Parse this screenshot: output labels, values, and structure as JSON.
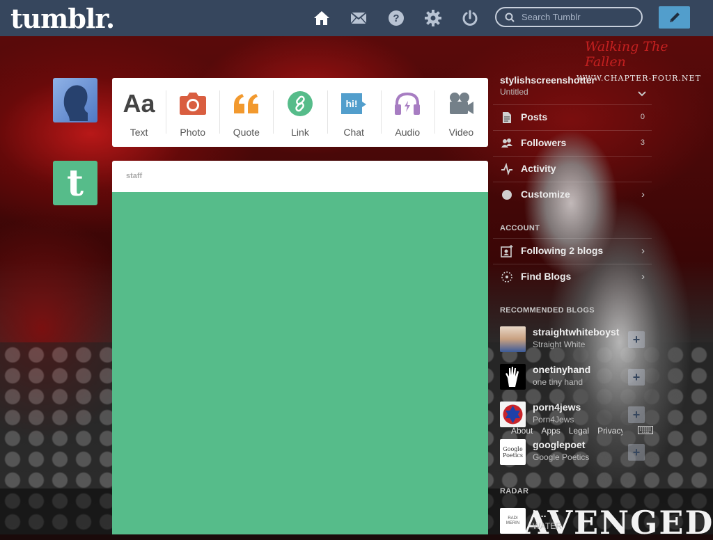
{
  "header": {
    "logo": "tumblr.",
    "search_placeholder": "Search Tumblr",
    "nav_icons": [
      "home-icon",
      "mail-icon",
      "help-icon",
      "settings-icon",
      "power-icon"
    ],
    "compose_icon": "pencil-icon"
  },
  "background": {
    "brand_line1": "Walking The Fallen",
    "brand_line2": "WWW.CHAPTER-FOUR.NET",
    "poster_text": "AVENGED"
  },
  "post_types": [
    {
      "label": "Text",
      "icon_text": "Aa"
    },
    {
      "label": "Photo"
    },
    {
      "label": "Quote"
    },
    {
      "label": "Link"
    },
    {
      "label": "Chat",
      "icon_text": "hi!"
    },
    {
      "label": "Audio"
    },
    {
      "label": "Video"
    }
  ],
  "post": {
    "author": "staff",
    "status": "loading"
  },
  "staff_avatar_letter": "t",
  "sidebar": {
    "blog_name": "stylishscreenshotter",
    "blog_title": "Untitled",
    "menu": [
      {
        "label": "Posts",
        "count": "0"
      },
      {
        "label": "Followers",
        "count": "3"
      },
      {
        "label": "Activity"
      },
      {
        "label": "Customize",
        "chevron": "›"
      }
    ],
    "account_label": "ACCOUNT",
    "account": [
      {
        "label": "Following 2 blogs",
        "chevron": "›"
      },
      {
        "label": "Find Blogs",
        "chevron": "›"
      }
    ],
    "recommended_label": "RECOMMENDED BLOGS",
    "recommended": [
      {
        "name": "straightwhiteboyst",
        "title": "Straight White",
        "follow": "+"
      },
      {
        "name": "onetinyhand",
        "title": "one tiny hand",
        "follow": "+"
      },
      {
        "name": "porn4jews",
        "title": "Porn4Jews",
        "follow": "+"
      },
      {
        "name": "googlepoet",
        "title": "Google Poetics",
        "avatar_text": "Google Poetics",
        "follow": "+"
      }
    ],
    "footer_links": [
      "About",
      "Apps",
      "Legal",
      "Privacy"
    ],
    "radar_label": "RADAR",
    "radar": {
      "name": "k...",
      "title": "WATER",
      "avatar_text": "RADI MERIN"
    }
  },
  "colors": {
    "header_bg": "#36465d",
    "compose_bg": "#529ecc",
    "post_green": "#56bc8a",
    "text_icon": "#444444",
    "photo_icon": "#d95e40",
    "quote_icon": "#f2992e",
    "link_icon": "#56bc8a",
    "chat_icon": "#529ecc",
    "audio_icon": "#a77dc2",
    "video_icon": "#748089"
  }
}
